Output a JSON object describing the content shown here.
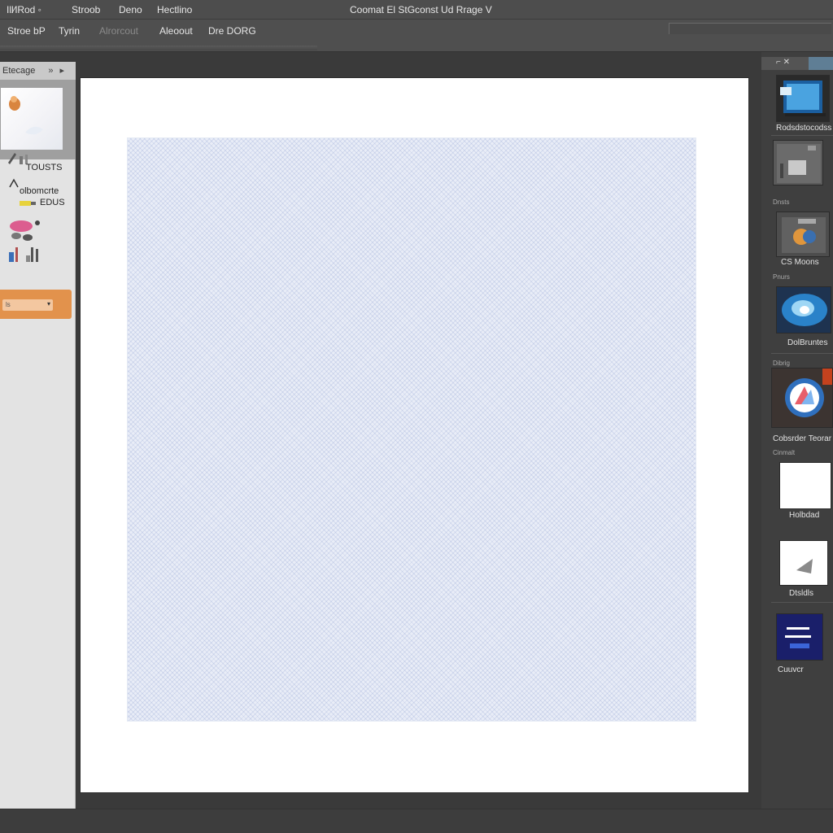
{
  "menu": {
    "items": [
      "Ιll⁄lRod ◦",
      "Stroob",
      "Deno",
      "Hectlino"
    ],
    "window_title": "Coomat El StGconst Ud Rrage V"
  },
  "options": {
    "items": [
      "Stroe bP",
      "Tyrin",
      "Alrorcout",
      "Aleoout",
      "Dre DORG"
    ]
  },
  "left_panel": {
    "header": "Etecage",
    "labels": [
      "TOUSTS",
      "olbomcrte",
      "EDUS"
    ],
    "field_value": "ls"
  },
  "right_panel": {
    "captions": [
      "Rodsdstocodss",
      "CS Moons",
      "DolBruntes",
      "Cobsrder Teorar",
      "Holbdad",
      "Dtsldls",
      "Cuuvcr"
    ],
    "section_labels": [
      "Dnsts",
      "Pnurs",
      "Dibrig",
      "Cinmalt"
    ]
  },
  "colors": {
    "chrome_dark": "#3a3a3a",
    "menu_bar": "#4d4d4d",
    "left_panel_bg": "#e3e3e3",
    "accent_orange": "#e2924c",
    "pattern_tint": "#e9edf7",
    "artboard": "#ffffff"
  },
  "icons": [
    "window-menu-icon",
    "panel-collapse-icon",
    "panel-arrow-icon",
    "brush-icon",
    "eraser-icon",
    "stamp-icon",
    "arrow-tool-icon",
    "dropdown-arrow-icon"
  ]
}
